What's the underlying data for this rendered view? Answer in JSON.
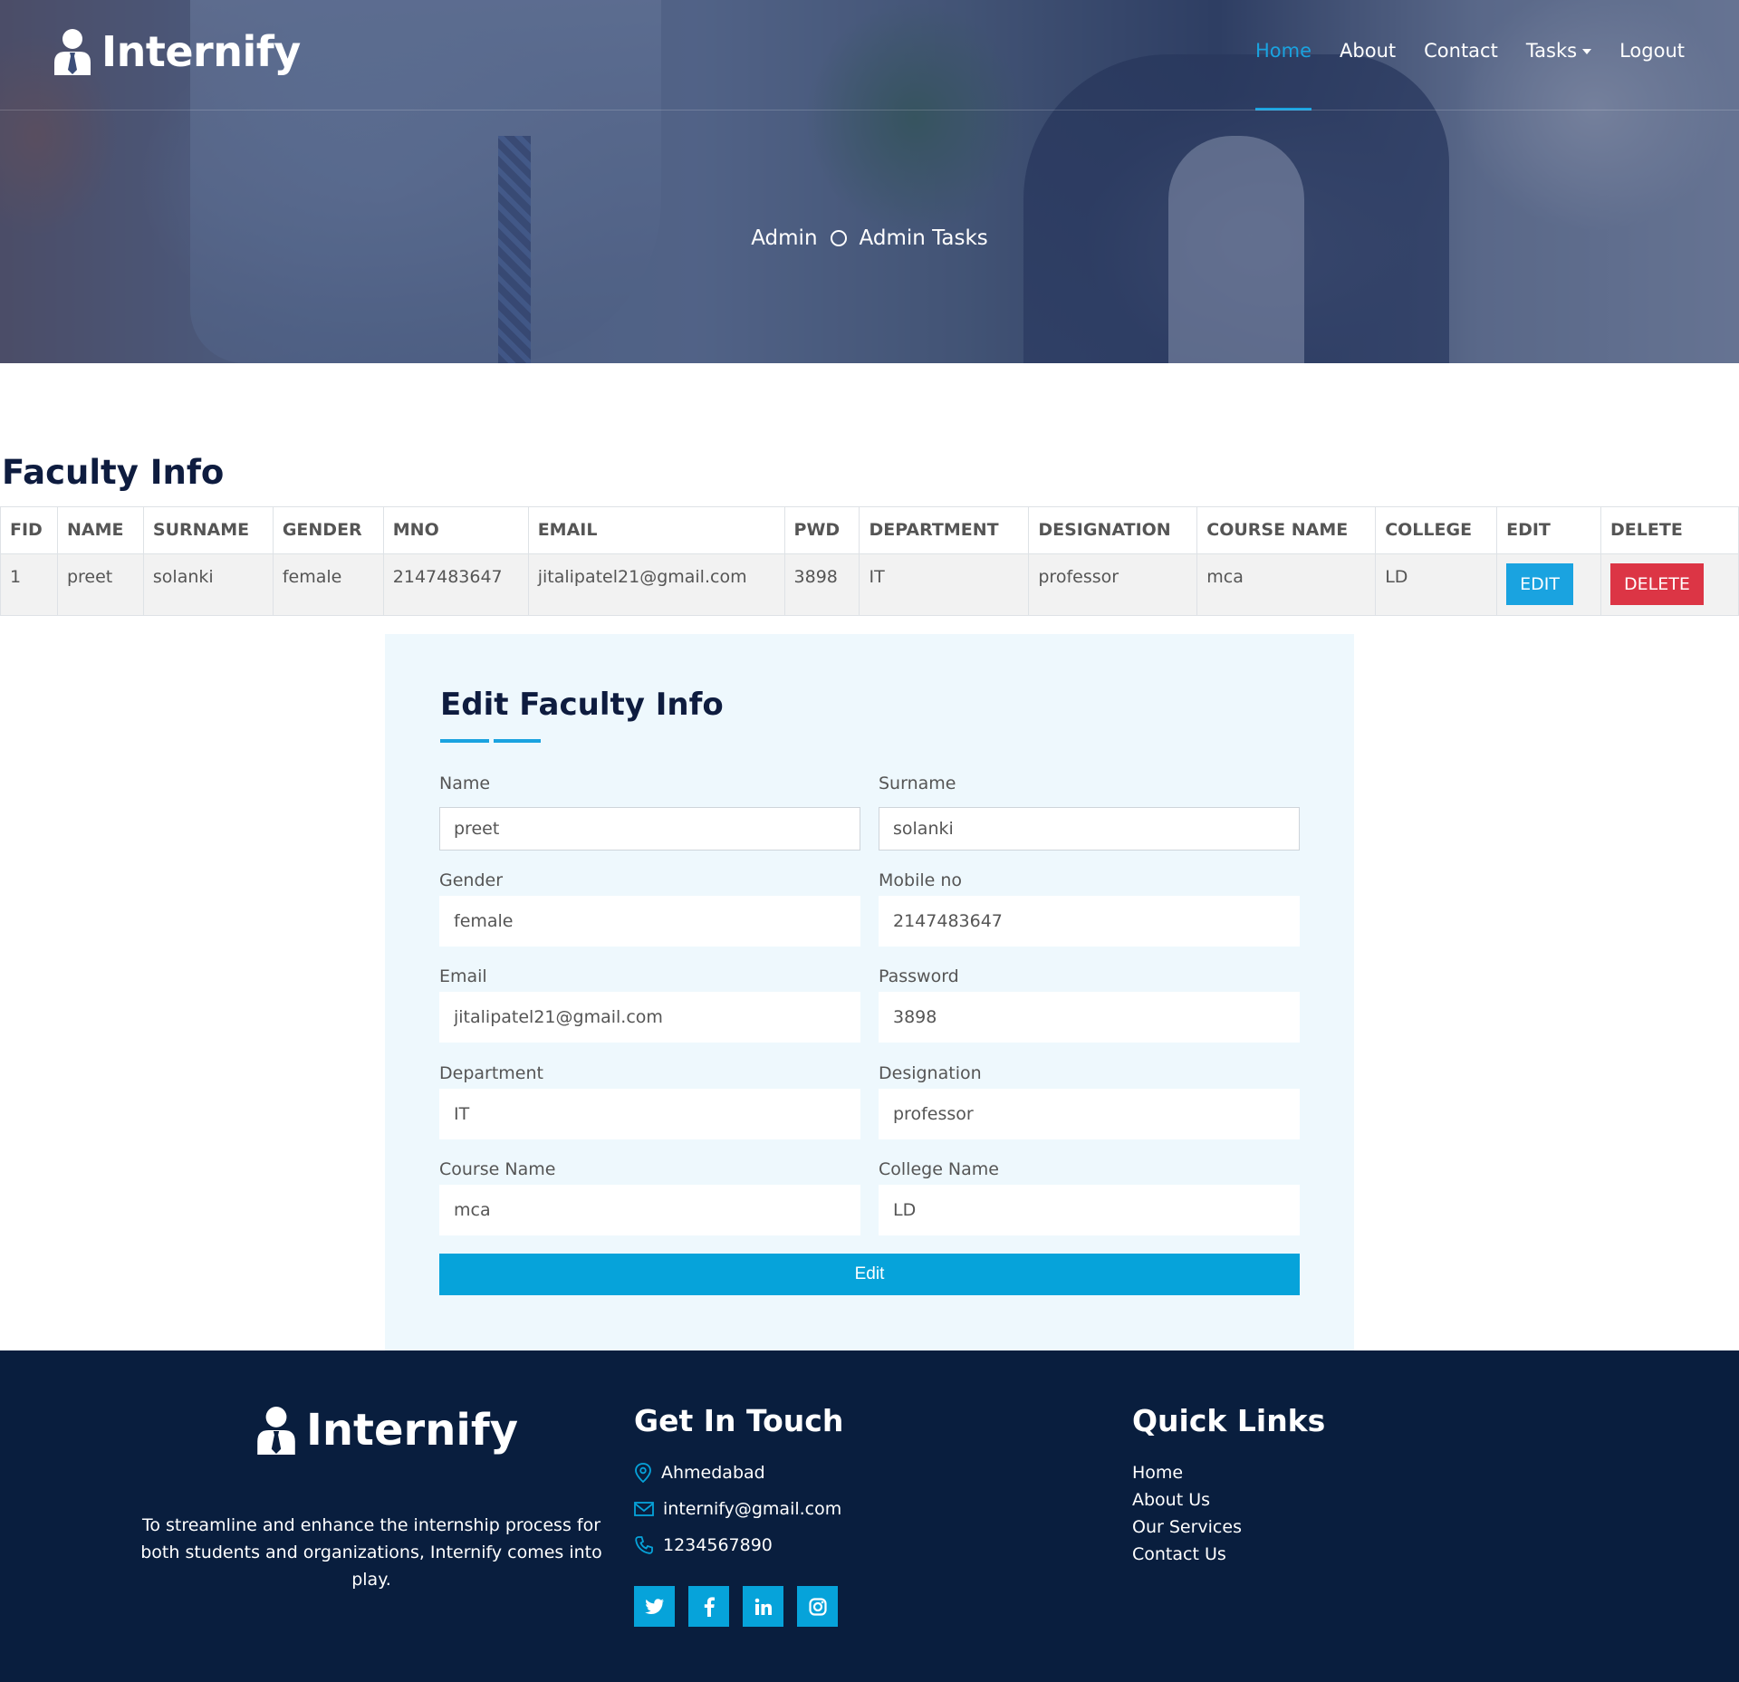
{
  "brand": {
    "name": "Internify"
  },
  "nav": {
    "items": [
      {
        "label": "Home",
        "active": true
      },
      {
        "label": "About"
      },
      {
        "label": "Contact"
      },
      {
        "label": "Tasks",
        "dropdown": true
      },
      {
        "label": "Logout"
      }
    ]
  },
  "breadcrumb": {
    "first": "Admin",
    "second": "Admin Tasks"
  },
  "faculty_section": {
    "title": "Faculty Info"
  },
  "table": {
    "headers": [
      "FID",
      "NAME",
      "SURNAME",
      "GENDER",
      "MNO",
      "EMAIL",
      "PWD",
      "DEPARTMENT",
      "DESIGNATION",
      "COURSE NAME",
      "COLLEGE",
      "EDIT",
      "DELETE"
    ],
    "rows": [
      {
        "fid": "1",
        "name": "preet",
        "surname": "solanki",
        "gender": "female",
        "mno": "2147483647",
        "email": "jitalipatel21@gmail.com",
        "pwd": "3898",
        "department": "IT",
        "designation": "professor",
        "course": "mca",
        "college": "LD",
        "edit_label": "EDIT",
        "delete_label": "DELETE"
      }
    ]
  },
  "form": {
    "title": "Edit Faculty Info",
    "fields": {
      "name": {
        "label": "Name",
        "value": "preet"
      },
      "surname": {
        "label": "Surname",
        "value": "solanki"
      },
      "gender": {
        "label": "Gender",
        "value": "female"
      },
      "mobile": {
        "label": "Mobile no",
        "value": "2147483647"
      },
      "email": {
        "label": "Email",
        "value": "jitalipatel21@gmail.com"
      },
      "password": {
        "label": "Password",
        "value": "3898"
      },
      "department": {
        "label": "Department",
        "value": "IT"
      },
      "designation": {
        "label": "Designation",
        "value": "professor"
      },
      "course": {
        "label": "Course Name",
        "value": "mca"
      },
      "college": {
        "label": "College Name",
        "value": "LD"
      }
    },
    "submit_label": "Edit"
  },
  "footer": {
    "brand": "Internify",
    "about": "To streamline and enhance the internship process for both students and organizations, Internify comes into play.",
    "get_in_touch": {
      "title": "Get In Touch",
      "location": "Ahmedabad",
      "email": "internify@gmail.com",
      "phone": "1234567890"
    },
    "socials": [
      "twitter-icon",
      "facebook-icon",
      "linkedin-icon",
      "instagram-icon"
    ],
    "quick_links": {
      "title": "Quick Links",
      "items": [
        "Home",
        "About Us",
        "Our Services",
        "Contact Us"
      ]
    }
  },
  "colors": {
    "primary": "#1aa3e0",
    "button": "#06a3da",
    "danger": "#dc3545",
    "dark": "#091e3e",
    "form_bg": "#eef8fd"
  }
}
